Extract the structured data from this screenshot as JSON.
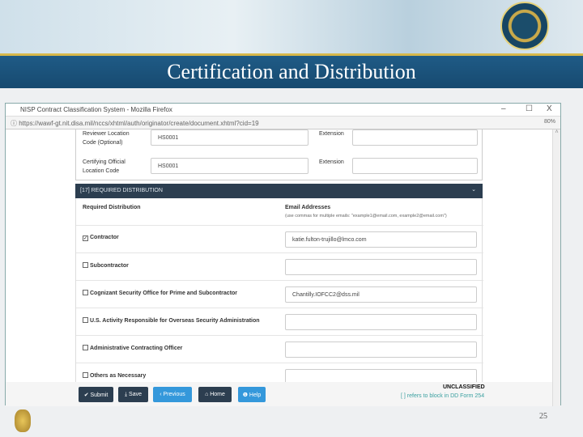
{
  "slide": {
    "title": "Certification and Distribution",
    "page_number": "25"
  },
  "browser": {
    "window_title": "NISP Contract Classification System - Mozilla Firefox",
    "url": "https://wawf-gt.nit.disa.mil/nccs/xhtml/auth/originator/create/document.xhtml?cid=19",
    "zoom": "80%",
    "minimize": "–",
    "maximize": "☐",
    "close": "X"
  },
  "form": {
    "reviewer_label": "Reviewer Location Code (Optional)",
    "reviewer_value": "HS0001",
    "certifying_label": "Certifying Official Location Code",
    "certifying_value": "HS0001",
    "extension_label": "Extension",
    "section_title": "[17] REQUIRED DISTRIBUTION",
    "section_chevron": "⌄",
    "col_distribution": "Required Distribution",
    "col_email": "Email Addresses",
    "email_hint": "(use commas for multiple emails: \"example1@email.com, example2@email.com\")",
    "rows": [
      {
        "label": "Contractor",
        "checked": "✓",
        "email": "katie.fulton-trujillo@lmco.com"
      },
      {
        "label": "Subcontractor",
        "checked": "",
        "email": ""
      },
      {
        "label": "Cognizant Security Office for Prime and Subcontractor",
        "checked": "",
        "email": "Chantilly.IOFCC2@dss.mil"
      },
      {
        "label": "U.S. Activity Responsible for Overseas Security Administration",
        "checked": "",
        "email": ""
      },
      {
        "label": "Administrative Contracting Officer",
        "checked": "",
        "email": ""
      },
      {
        "label": "Others as Necessary",
        "checked": "",
        "email": ""
      }
    ]
  },
  "footer": {
    "submit": "✔ Submit",
    "save": "⤓ Save",
    "previous": "‹ Previous",
    "home": "⌂ Home",
    "help": "❶ Help",
    "classification": "UNCLASSIFIED",
    "refnote": "[ ] refers to block in DD Form 254"
  }
}
